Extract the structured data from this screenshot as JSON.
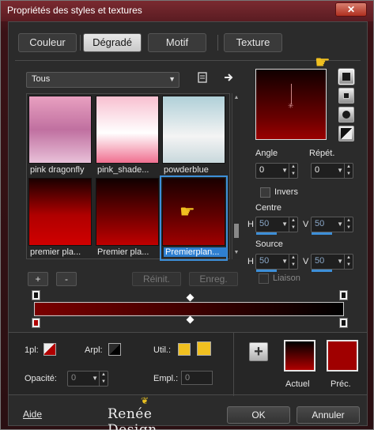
{
  "window": {
    "title": "Propriétés des styles et textures",
    "close_label": "✕"
  },
  "tabs": [
    {
      "label": "Couleur"
    },
    {
      "label": "Dégradé"
    },
    {
      "label": "Motif"
    },
    {
      "label": "Texture"
    }
  ],
  "active_tab": "Dégradé",
  "filter": {
    "value": "Tous"
  },
  "gradients": [
    {
      "name": "pink dragonfly",
      "colors": [
        "#f0a8c8",
        "#c06090",
        "#e8b8d0"
      ]
    },
    {
      "name": "pink_shade...",
      "colors": [
        "#f8c8d8",
        "#ffffff",
        "#f080a0"
      ]
    },
    {
      "name": "powderblue",
      "colors": [
        "#b8d8e0",
        "#f0f0f0",
        "#c8d8dc"
      ]
    },
    {
      "name": "premier pla...",
      "colors": [
        "#200000",
        "#b00000",
        "#d00000"
      ]
    },
    {
      "name": "Premier pla...",
      "colors": [
        "#100000",
        "#700000",
        "#c00000"
      ]
    },
    {
      "name": "Premierplan...",
      "colors": [
        "#1a0000",
        "#600000",
        "#a00000"
      ],
      "selected": true
    }
  ],
  "buttons": {
    "add": "+",
    "remove": "-",
    "reset": "Réinit.",
    "save": "Enreg."
  },
  "angle": {
    "label": "Angle",
    "value": "0"
  },
  "repeat": {
    "label": "Répét.",
    "value": "0"
  },
  "invert": {
    "label": "Invers",
    "checked": false
  },
  "center": {
    "label": "Centre",
    "h_label": "H",
    "h_value": "50",
    "v_label": "V",
    "v_value": "50"
  },
  "source": {
    "label": "Source",
    "h_label": "H",
    "h_value": "50",
    "v_label": "V",
    "v_value": "50"
  },
  "link": {
    "label": "Liaison",
    "checked": false
  },
  "stop": {
    "location_label": "1pl:",
    "arpl_label": "Arpl:",
    "util_label": "Util.:",
    "opacity_label": "Opacité:",
    "opacity_value": "0",
    "empl_label": "Empl.:",
    "empl_value": "0"
  },
  "swatches": {
    "current_label": "Actuel",
    "previous_label": "Préc.",
    "current_colors": [
      "#000000",
      "#b00000"
    ],
    "previous_color": "#a00000"
  },
  "footer": {
    "help": "Aide",
    "brand": "Renée Design",
    "ok": "OK",
    "cancel": "Annuler"
  },
  "icons": {
    "new_doc": "document-icon",
    "arrow": "arrow-right-icon",
    "pointer": "pointing-hand-icon"
  }
}
